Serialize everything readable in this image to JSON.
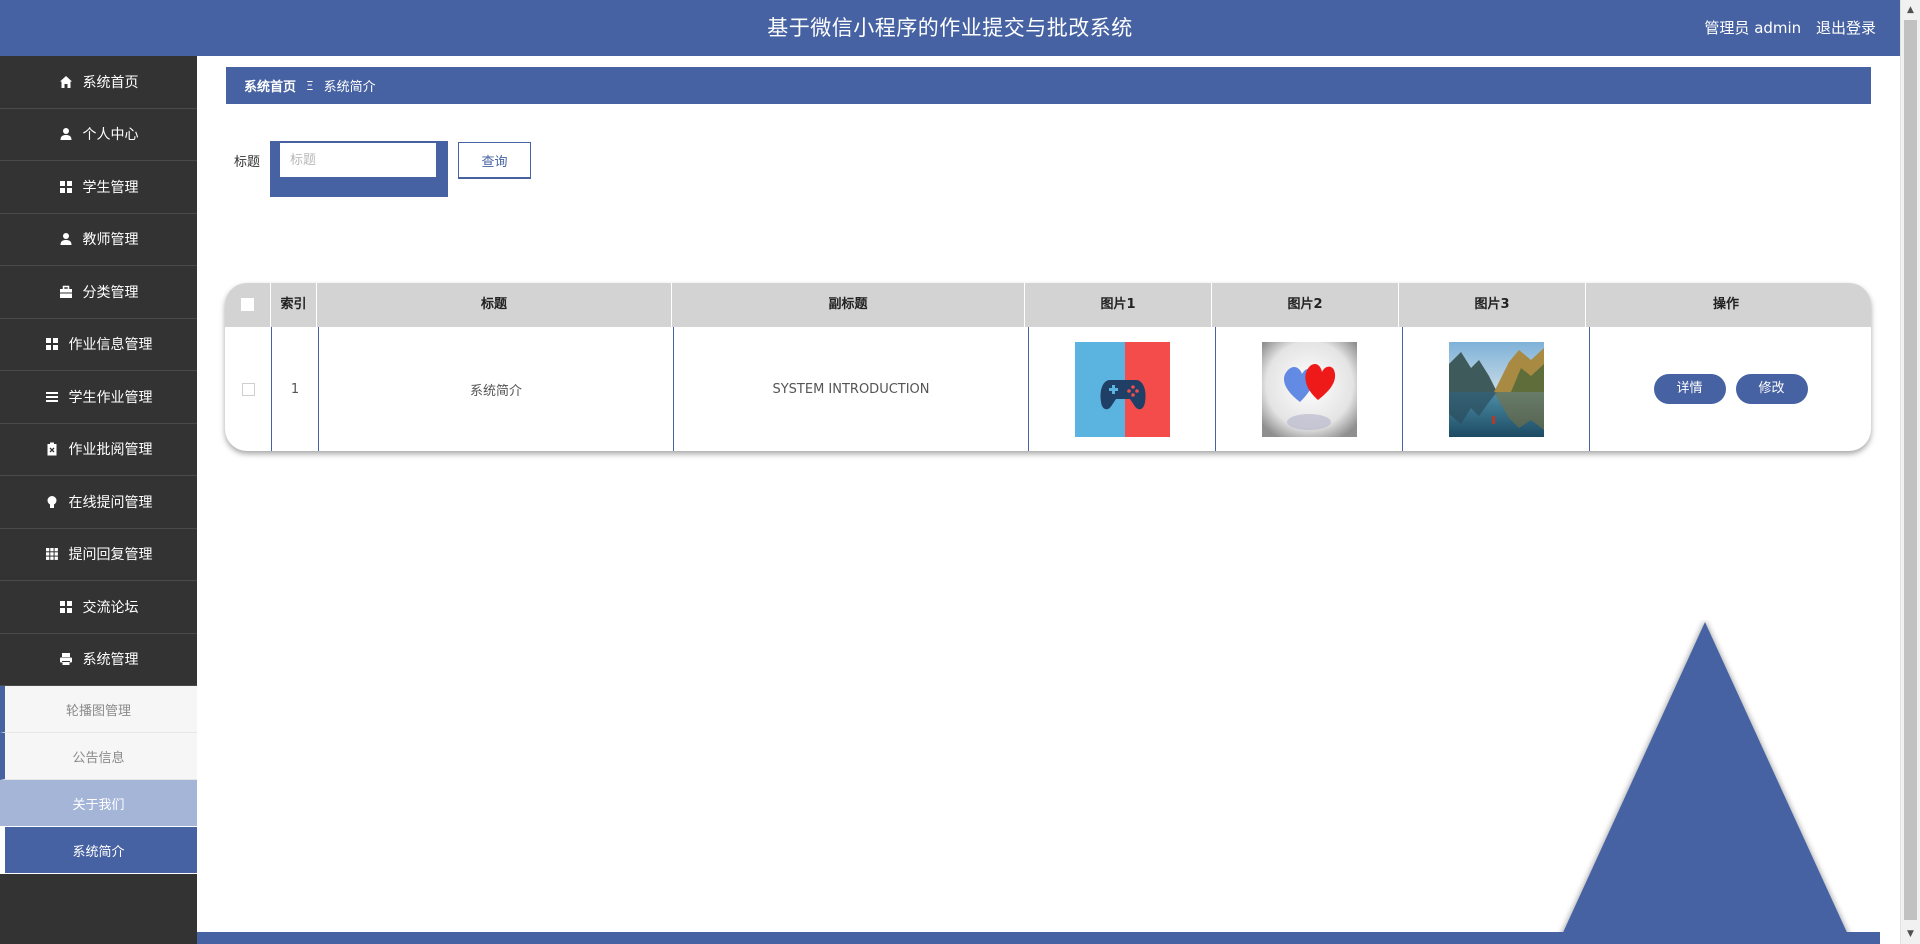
{
  "header": {
    "title": "基于微信小程序的作业提交与批改系统",
    "user": "管理员 admin",
    "logout": "退出登录"
  },
  "sidebar": {
    "items": [
      {
        "label": "系统首页",
        "icon": "home-icon"
      },
      {
        "label": "个人中心",
        "icon": "user-icon"
      },
      {
        "label": "学生管理",
        "icon": "grid-icon"
      },
      {
        "label": "教师管理",
        "icon": "user-icon"
      },
      {
        "label": "分类管理",
        "icon": "briefcase-icon"
      },
      {
        "label": "作业信息管理",
        "icon": "grid-icon"
      },
      {
        "label": "学生作业管理",
        "icon": "list-icon"
      },
      {
        "label": "作业批阅管理",
        "icon": "clipboard-icon"
      },
      {
        "label": "在线提问管理",
        "icon": "bulb-icon"
      },
      {
        "label": "提问回复管理",
        "icon": "grid-nine-icon"
      },
      {
        "label": "交流论坛",
        "icon": "grid-icon"
      },
      {
        "label": "系统管理",
        "icon": "printer-icon"
      }
    ],
    "sub_items": [
      {
        "label": "轮播图管理"
      },
      {
        "label": "公告信息"
      },
      {
        "label": "关于我们"
      },
      {
        "label": "系统简介"
      }
    ]
  },
  "breadcrumb": {
    "home": "系统首页",
    "separator": "Ξ",
    "current": "系统简介"
  },
  "search": {
    "label": "标题",
    "placeholder": "标题",
    "value": "",
    "button": "查询"
  },
  "table": {
    "columns": [
      "索引",
      "标题",
      "副标题",
      "图片1",
      "图片2",
      "图片3",
      "操作"
    ],
    "rows": [
      {
        "index": "1",
        "title": "系统简介",
        "subtitle": "SYSTEM INTRODUCTION",
        "images": [
          "gamepad-image",
          "hearts-image",
          "lake-mountain-image"
        ],
        "actions": [
          "详情",
          "修改"
        ]
      }
    ]
  },
  "colors": {
    "primary": "#4662a2",
    "sidebar_bg": "#333333",
    "sub_light": "#a4b5d8",
    "header_row": "#d3d3d3"
  }
}
